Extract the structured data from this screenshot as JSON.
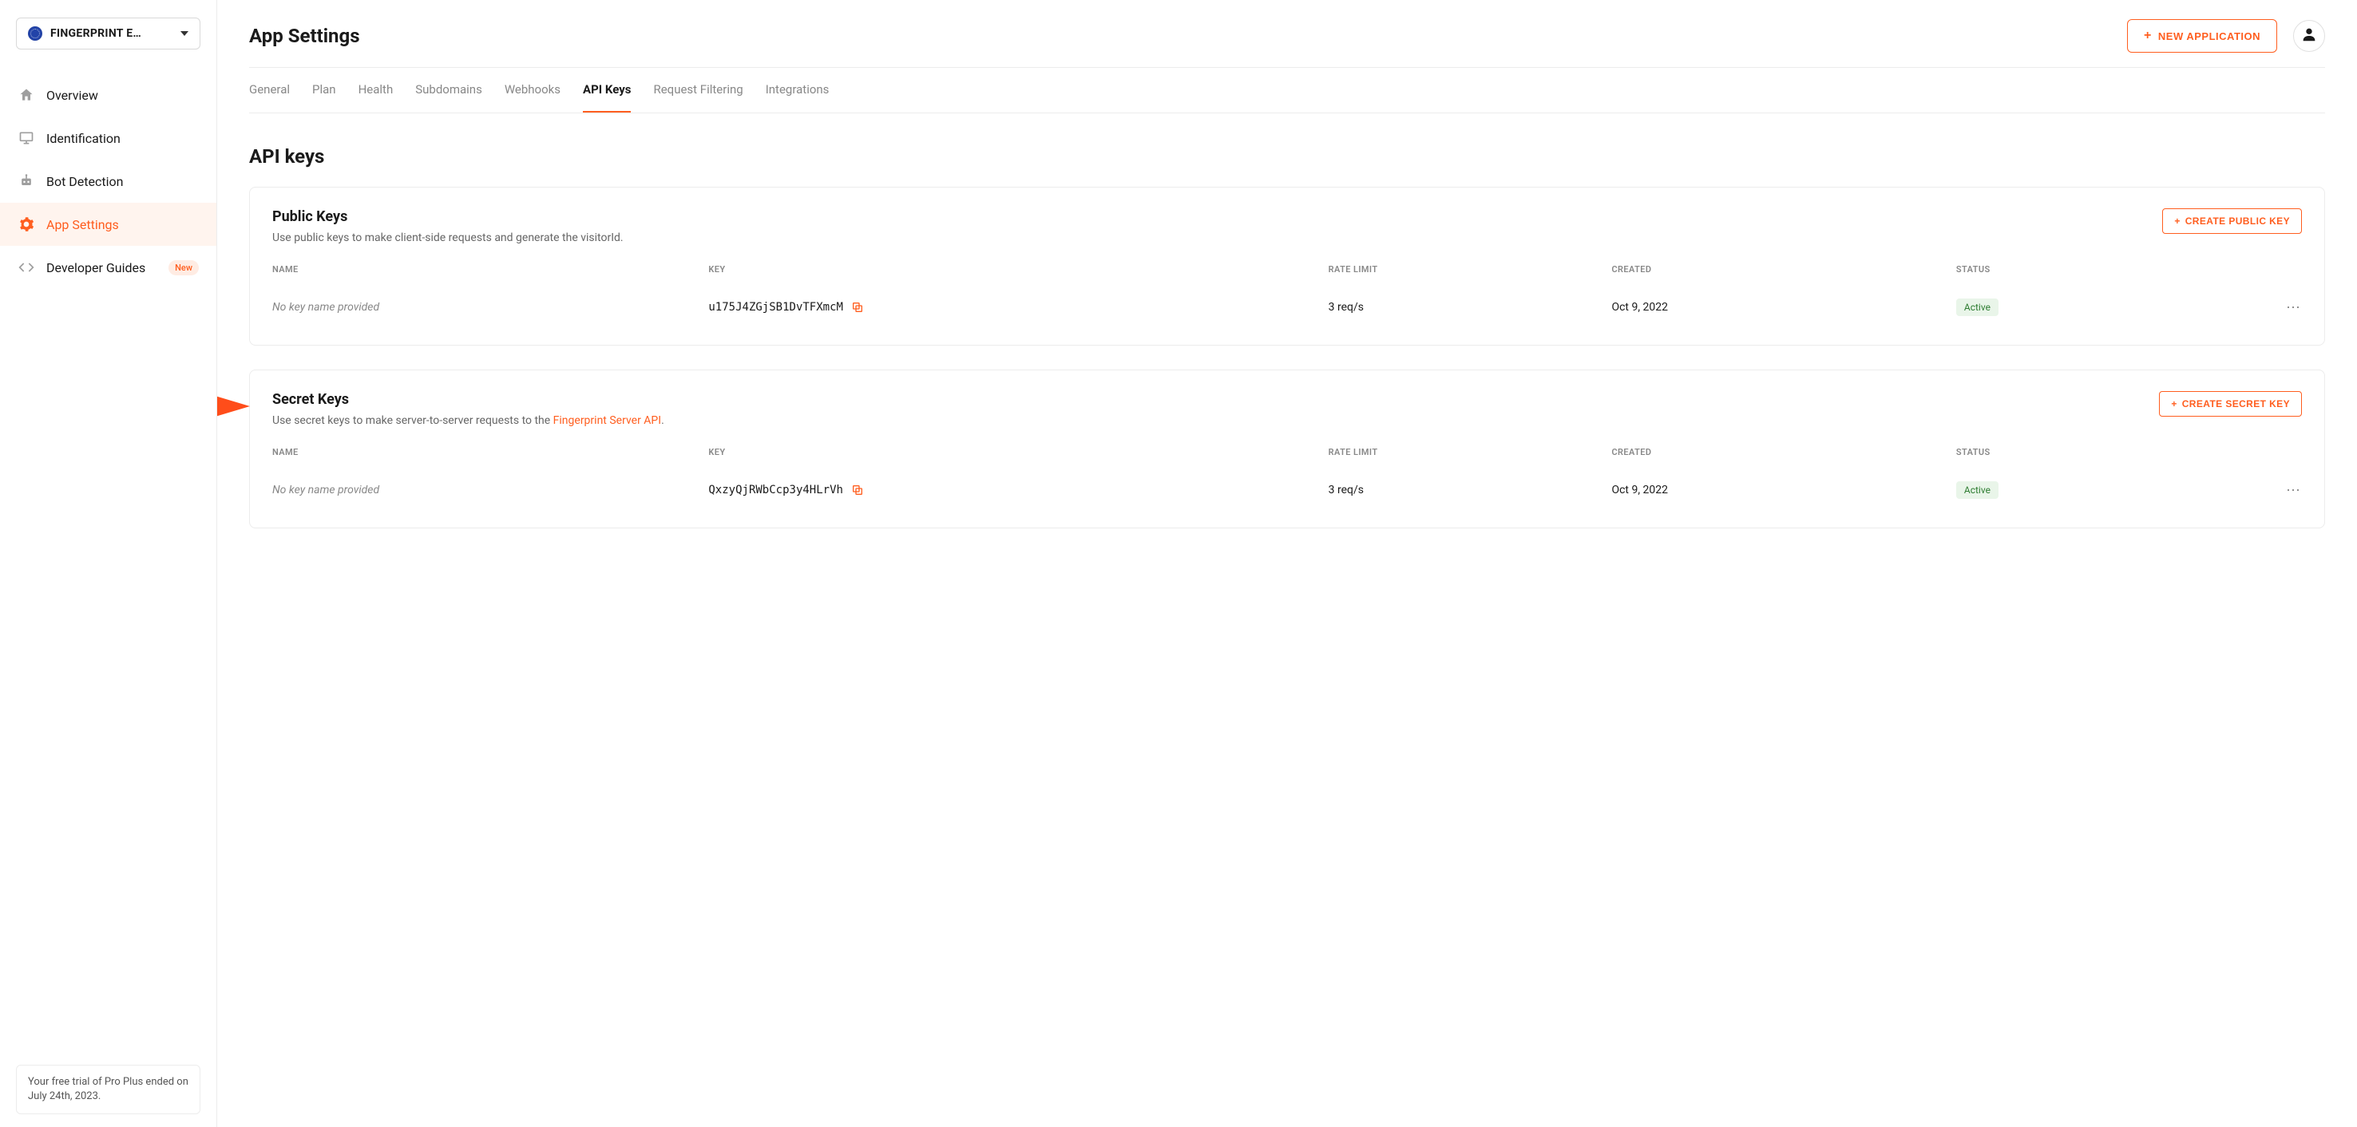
{
  "app_selector": {
    "label": "FINGERPRINT E…"
  },
  "sidebar": {
    "items": [
      {
        "label": "Overview"
      },
      {
        "label": "Identification"
      },
      {
        "label": "Bot Detection"
      },
      {
        "label": "App Settings"
      },
      {
        "label": "Developer Guides",
        "badge": "New"
      }
    ]
  },
  "trial_notice": "Your free trial of Pro Plus ended on July 24th, 2023.",
  "header": {
    "title": "App Settings",
    "new_app_button": "NEW APPLICATION"
  },
  "tabs": [
    {
      "label": "General"
    },
    {
      "label": "Plan"
    },
    {
      "label": "Health"
    },
    {
      "label": "Subdomains"
    },
    {
      "label": "Webhooks"
    },
    {
      "label": "API Keys"
    },
    {
      "label": "Request Filtering"
    },
    {
      "label": "Integrations"
    }
  ],
  "section": {
    "title": "API keys"
  },
  "columns": {
    "name": "NAME",
    "key": "KEY",
    "rate": "RATE LIMIT",
    "created": "CREATED",
    "status": "STATUS"
  },
  "public_card": {
    "title": "Public Keys",
    "desc": "Use public keys to make client-side requests and generate the visitorId.",
    "button": "CREATE PUBLIC KEY",
    "row": {
      "name": "No key name provided",
      "key": "u175J4ZGjSB1DvTFXmcM",
      "rate": "3 req/s",
      "created": "Oct 9, 2022",
      "status": "Active"
    }
  },
  "secret_card": {
    "title": "Secret Keys",
    "desc_prefix": "Use secret keys to make server-to-server requests to the ",
    "desc_link": "Fingerprint Server API",
    "desc_suffix": ".",
    "button": "CREATE SECRET KEY",
    "row": {
      "name": "No key name provided",
      "key": "QxzyQjRWbCcp3y4HLrVh",
      "rate": "3 req/s",
      "created": "Oct 9, 2022",
      "status": "Active"
    }
  }
}
